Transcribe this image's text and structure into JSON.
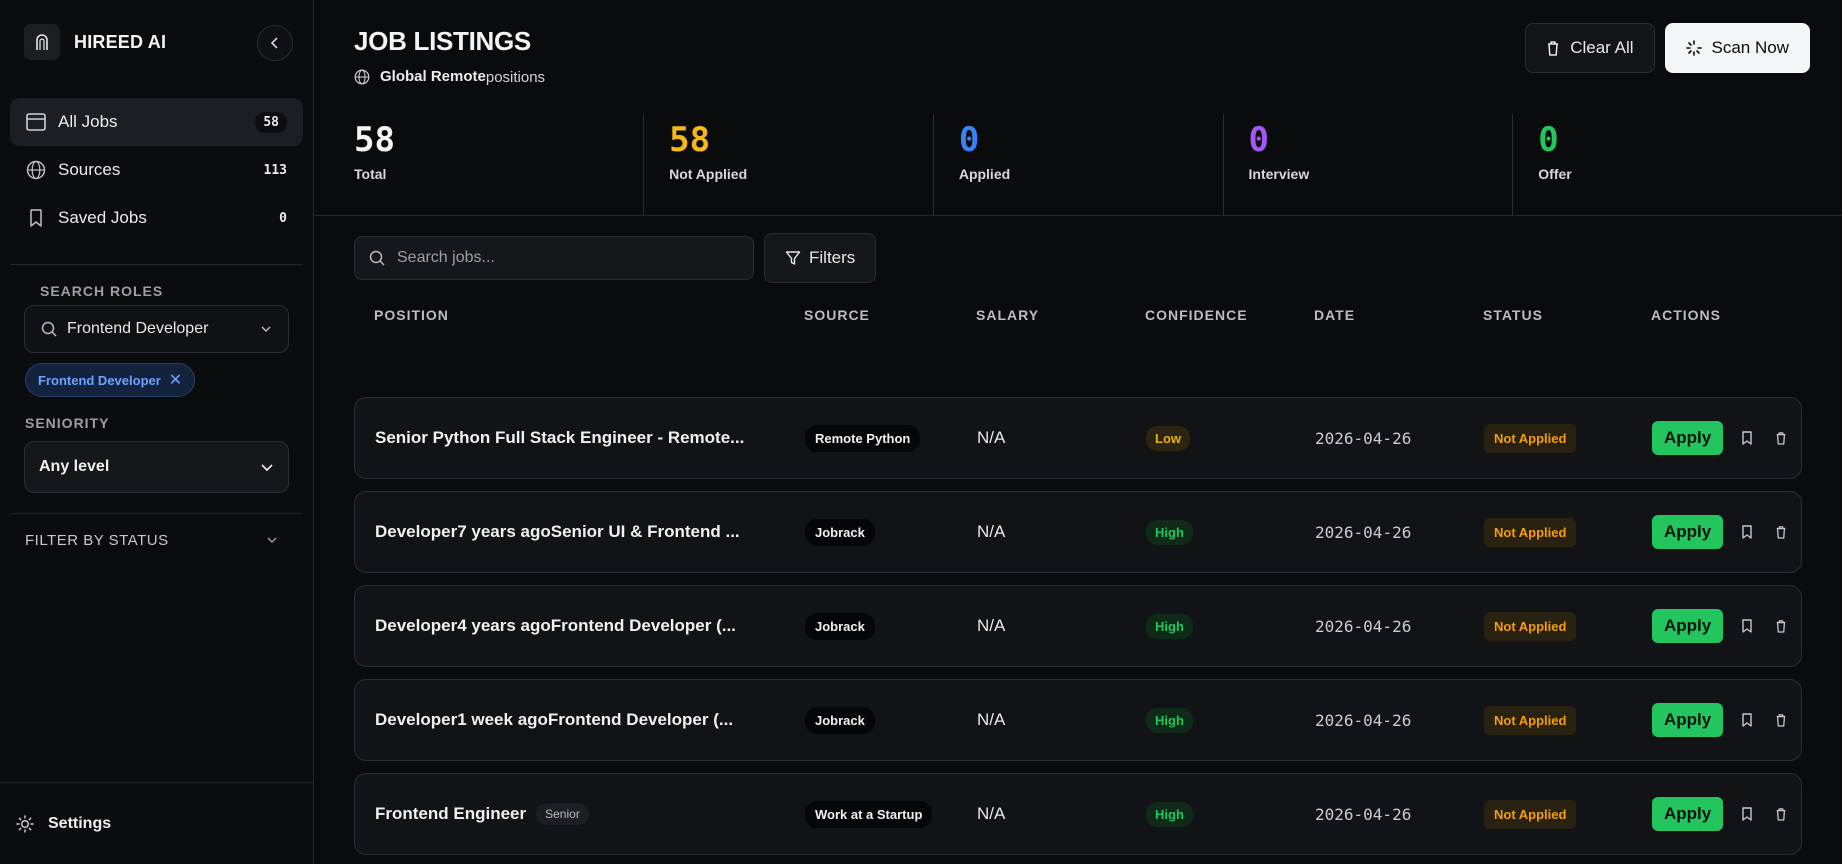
{
  "brand": {
    "name": "HIREED AI"
  },
  "sidebar": {
    "nav": [
      {
        "label": "All Jobs",
        "count": "58",
        "icon": "browser-window-icon"
      },
      {
        "label": "Sources",
        "count": "113",
        "icon": "globe-icon"
      },
      {
        "label": "Saved Jobs",
        "count": "0",
        "icon": "bookmark-icon"
      }
    ],
    "search_roles_title": "SEARCH ROLES",
    "role_value": "Frontend Developer",
    "role_chip": "Frontend Developer",
    "seniority_title": "SENIORITY",
    "seniority_value": "Any level",
    "status_filter_title": "FILTER BY STATUS",
    "settings_label": "Settings"
  },
  "header": {
    "title": "JOB LISTINGS",
    "subtitle_bold": "Global Remote",
    "subtitle_rest": "positions",
    "clear_label": "Clear All",
    "scan_label": "Scan Now"
  },
  "stats": [
    {
      "value": "58",
      "label": "Total",
      "color": "#f3f4f6"
    },
    {
      "value": "58",
      "label": "Not Applied",
      "color": "#f5b814"
    },
    {
      "value": "0",
      "label": "Applied",
      "color": "#3b82f6"
    },
    {
      "value": "0",
      "label": "Interview",
      "color": "#a855f7"
    },
    {
      "value": "0",
      "label": "Offer",
      "color": "#22c55e"
    }
  ],
  "toolbar": {
    "search_placeholder": "Search jobs...",
    "filters_label": "Filters"
  },
  "table": {
    "headers": [
      "POSITION",
      "SOURCE",
      "SALARY",
      "CONFIDENCE",
      "DATE",
      "STATUS",
      "ACTIONS"
    ],
    "rows": [
      {
        "position": "Senior Python Full Stack Engineer - Remote...",
        "tag": "",
        "source": "Remote Python",
        "salary": "N/A",
        "confidence": "Low",
        "date": "2026-04-26",
        "status": "Not Applied",
        "action": "Apply"
      },
      {
        "position": "Developer7 years agoSenior UI & Frontend ...",
        "tag": "",
        "source": "Jobrack",
        "salary": "N/A",
        "confidence": "High",
        "date": "2026-04-26",
        "status": "Not Applied",
        "action": "Apply"
      },
      {
        "position": "Developer4 years agoFrontend Developer (...",
        "tag": "",
        "source": "Jobrack",
        "salary": "N/A",
        "confidence": "High",
        "date": "2026-04-26",
        "status": "Not Applied",
        "action": "Apply"
      },
      {
        "position": "Developer1 week agoFrontend Developer (...",
        "tag": "",
        "source": "Jobrack",
        "salary": "N/A",
        "confidence": "High",
        "date": "2026-04-26",
        "status": "Not Applied",
        "action": "Apply"
      },
      {
        "position": "Frontend Engineer",
        "tag": "Senior",
        "source": "Work at a Startup",
        "salary": "N/A",
        "confidence": "High",
        "date": "2026-04-26",
        "status": "Not Applied",
        "action": "Apply"
      }
    ]
  }
}
